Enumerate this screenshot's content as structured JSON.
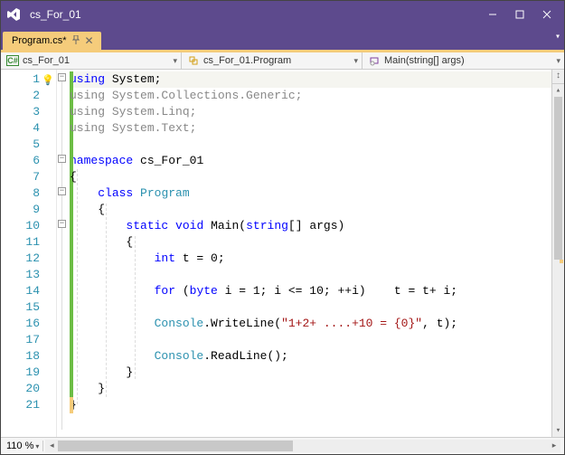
{
  "window": {
    "title": "cs_For_01"
  },
  "tab": {
    "label": "Program.cs*"
  },
  "nav": {
    "scope": "cs_For_01",
    "scope_icon": "C#",
    "class": "cs_For_01.Program",
    "method": "Main(string[] args)"
  },
  "zoom": "110 %",
  "lines_count": 21,
  "code": {
    "l1": {
      "using": "using",
      "sys": "System"
    },
    "l2": {
      "using": "using",
      "ns": "System.Collections.Generic"
    },
    "l3": {
      "using": "using",
      "ns": "System.Linq"
    },
    "l4": {
      "using": "using",
      "ns": "System.Text"
    },
    "l6": {
      "kw": "namespace",
      "name": "cs_For_01"
    },
    "l7": "{",
    "l8": {
      "kw": "class",
      "name": "Program"
    },
    "l9": "{",
    "l10": {
      "kw1": "static",
      "kw2": "void",
      "name": "Main",
      "kw3": "string",
      "args": "[] args"
    },
    "l11": "{",
    "l12": {
      "kw": "int",
      "rest": " t = 0;"
    },
    "l14": {
      "kw1": "for",
      "kw2": "byte",
      "rest1": " i = 1; i <= 10; ++i)    t = t+ i;"
    },
    "l16": {
      "typ": "Console",
      "m": ".WriteLine(",
      "str": "\"1+2+ ....+10 = {0}\"",
      "rest": ", t);"
    },
    "l18": {
      "typ": "Console",
      "m": ".ReadLine();"
    },
    "l19": "}",
    "l20": "}",
    "l21": "}"
  }
}
